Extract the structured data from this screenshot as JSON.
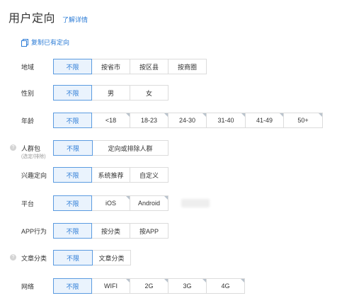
{
  "header": {
    "title": "用户定向",
    "learn_more": "了解详情"
  },
  "copy_targeting": "复制已有定向",
  "rows": {
    "region": {
      "label": "地域",
      "options": [
        "不限",
        "按省市",
        "按区县",
        "按商圈"
      ]
    },
    "gender": {
      "label": "性别",
      "options": [
        "不限",
        "男",
        "女"
      ]
    },
    "age": {
      "label": "年龄",
      "options": [
        "不限",
        "<18",
        "18-23",
        "24-30",
        "31-40",
        "41-49",
        "50+"
      ]
    },
    "audience": {
      "label": "人群包",
      "sublabel": "(选定/排除)",
      "options": [
        "不限",
        "定向或排除人群"
      ]
    },
    "interest": {
      "label": "兴趣定向",
      "options": [
        "不限",
        "系统推荐",
        "自定义"
      ]
    },
    "platform": {
      "label": "平台",
      "options": [
        "不限",
        "iOS",
        "Android"
      ]
    },
    "app": {
      "label": "APP行为",
      "options": [
        "不限",
        "按分类",
        "按APP"
      ]
    },
    "article": {
      "label": "文章分类",
      "options": [
        "不限",
        "文章分类"
      ]
    },
    "network": {
      "label": "网络",
      "options": [
        "不限",
        "WIFI",
        "2G",
        "3G",
        "4G"
      ]
    }
  },
  "selected_value": "不限",
  "colors": {
    "accent": "#2b7bd6",
    "active_bg": "#eaf3fd",
    "border": "#dcdcdc"
  },
  "icons": {
    "help": "question-circle-icon",
    "copy": "copy-icon"
  }
}
